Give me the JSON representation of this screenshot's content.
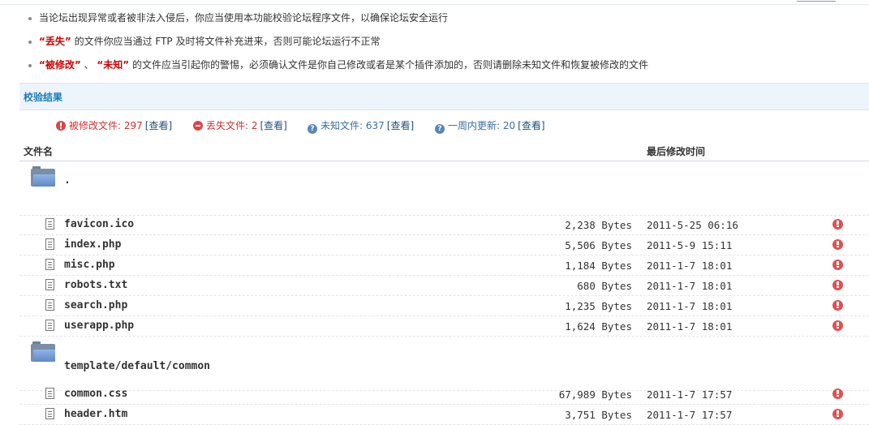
{
  "tips": [
    {
      "parts": [
        {
          "text": "当论坛出现异常或者被非法入侵后，你应当使用本功能校验论坛程序文件，以确保论坛安全运行",
          "red": false
        }
      ]
    },
    {
      "parts": [
        {
          "text": "“丢失”",
          "red": true
        },
        {
          "text": " 的文件你应当通过 FTP 及时将文件补充进来，否则可能论坛运行不正常",
          "red": false
        }
      ]
    },
    {
      "parts": [
        {
          "text": "“被修改”",
          "red": true
        },
        {
          "text": " 、 ",
          "red": false
        },
        {
          "text": "“未知”",
          "red": true
        },
        {
          "text": " 的文件应当引起你的警惕，必须确认文件是你自己修改或者是某个插件添加的，否则请删除未知文件和恢复被修改的文件",
          "red": false
        }
      ]
    }
  ],
  "section_title": "校验结果",
  "summary": [
    {
      "icon": "error-icon",
      "label": "被修改文件: 297",
      "link": "[查看]",
      "tone": "red"
    },
    {
      "icon": "minus-circle-icon",
      "label": "丢失文件: 2",
      "link": "[查看]",
      "tone": "red"
    },
    {
      "icon": "help-icon",
      "label": "未知文件: 637",
      "link": "[查看]",
      "tone": "blue"
    },
    {
      "icon": "help-icon",
      "label": "一周内更新: 20",
      "link": "[查看]",
      "tone": "blue"
    }
  ],
  "table": {
    "col_filename": "文件名",
    "col_modified": "最后修改时间"
  },
  "groups": [
    {
      "dir": ".",
      "files": [
        {
          "name": "favicon.ico",
          "size": "2,238 Bytes",
          "date": "2011-5-25 06:16"
        },
        {
          "name": "index.php",
          "size": "5,506 Bytes",
          "date": "2011-5-9 15:11"
        },
        {
          "name": "misc.php",
          "size": "1,184 Bytes",
          "date": "2011-1-7 18:01"
        },
        {
          "name": "robots.txt",
          "size": "680 Bytes",
          "date": "2011-1-7 18:01"
        },
        {
          "name": "search.php",
          "size": "1,235 Bytes",
          "date": "2011-1-7 18:01"
        },
        {
          "name": "userapp.php",
          "size": "1,624 Bytes",
          "date": "2011-1-7 18:01"
        }
      ]
    },
    {
      "dir": "template/default/common",
      "files": [
        {
          "name": "common.css",
          "size": "67,989 Bytes",
          "date": "2011-1-7 17:57"
        },
        {
          "name": "header.htm",
          "size": "3,751 Bytes",
          "date": "2011-1-7 17:57"
        }
      ]
    }
  ],
  "colors": {
    "accent": "#1a7bb5",
    "danger": "#d94646",
    "section_bg": "#eef4fb"
  }
}
